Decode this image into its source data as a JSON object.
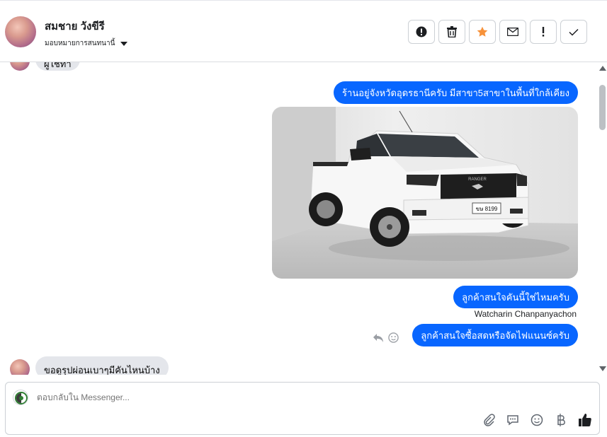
{
  "header": {
    "contact_name": "สมชาย วังขีรี",
    "assign_label": "มอบหมายการสนทนานี้",
    "actions": [
      {
        "name": "report-icon"
      },
      {
        "name": "trash-icon"
      },
      {
        "name": "star-icon"
      },
      {
        "name": "mail-icon"
      },
      {
        "name": "exclamation-icon"
      },
      {
        "name": "check-icon"
      }
    ]
  },
  "chat": {
    "top_partial_message": "ผู้ใช้ทำ",
    "messages_out": [
      {
        "text": "ร้านอยู่จังหวัดอุดรธานีครับ มีสาขา5สาขาในพื้นที่ใกล้เคียง"
      },
      {
        "text": "ลูกค้าสนใจคันนี้ใช่ไหมครับ"
      },
      {
        "text": "ลูกค้าสนใจซื้อสดหรือจัดไฟแนนซ์ครับ"
      }
    ],
    "sender_name": "Watcharin Chanpanyachon",
    "photo": {
      "plate": "ขษ 8199",
      "grille_text": "RANGER"
    },
    "message_in": "ขอดูรุปผ่อนเบาๆมีคันไหนบ้าง"
  },
  "composer": {
    "placeholder": "ตอบกลับใน Messenger...",
    "tools": [
      "paperclip-icon",
      "chat-bubble-icon",
      "smiley-icon",
      "baht-icon",
      "thumbs-up-icon"
    ]
  },
  "colors": {
    "accent": "#0866ff",
    "incoming_bubble": "#e4e6eb",
    "star": "#f7923a"
  }
}
